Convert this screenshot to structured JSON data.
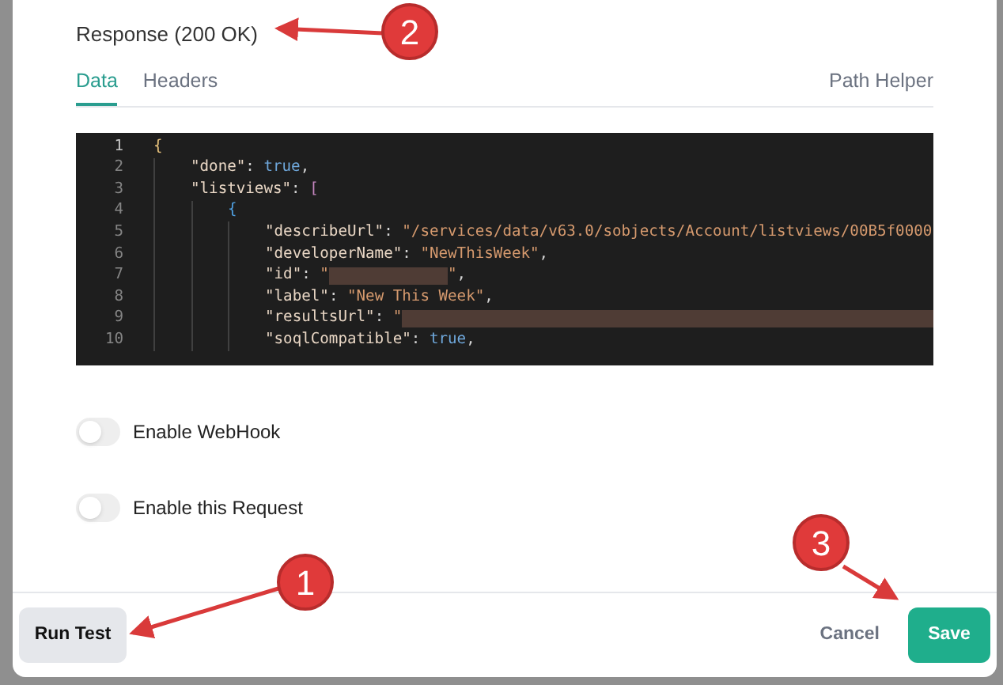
{
  "response": {
    "title": "Response (200 OK)"
  },
  "tabs": [
    {
      "label": "Data",
      "selected": true
    },
    {
      "label": "Headers",
      "selected": false
    }
  ],
  "path_helper": "Path Helper",
  "code_lines": [
    {
      "number": "1",
      "tokens": [
        {
          "kind": "bracket",
          "text": "{"
        }
      ],
      "children": [
        {
          "number": "2",
          "tokens": [
            {
              "kind": "key",
              "text": "\"done\""
            },
            {
              "kind": "punct",
              "text": ": "
            },
            {
              "kind": "literal",
              "text": "true"
            },
            {
              "kind": "punct",
              "text": ","
            }
          ]
        },
        {
          "number": "3",
          "tokens": [
            {
              "kind": "key",
              "text": "\"listviews\""
            },
            {
              "kind": "punct",
              "text": ": "
            },
            {
              "kind": "bracket2",
              "text": "["
            }
          ],
          "children": [
            {
              "number": "4",
              "tokens": [
                {
                  "kind": "bracket3",
                  "text": "{"
                }
              ],
              "children": [
                {
                  "number": "5",
                  "tokens": [
                    {
                      "kind": "key",
                      "text": "\"describeUrl\""
                    },
                    {
                      "kind": "punct",
                      "text": ": "
                    },
                    {
                      "kind": "string",
                      "text": "\"/services/data/v63.0/sobjects/Account/listviews/00B5f0000"
                    }
                  ]
                },
                {
                  "number": "6",
                  "tokens": [
                    {
                      "kind": "key",
                      "text": "\"developerName\""
                    },
                    {
                      "kind": "punct",
                      "text": ": "
                    },
                    {
                      "kind": "string",
                      "text": "\"NewThisWeek\""
                    },
                    {
                      "kind": "punct",
                      "text": ","
                    }
                  ]
                },
                {
                  "number": "7",
                  "tokens": [
                    {
                      "kind": "key",
                      "text": "\"id\""
                    },
                    {
                      "kind": "punct",
                      "text": ": "
                    },
                    {
                      "kind": "string",
                      "text": "\""
                    },
                    {
                      "kind": "redacted-short"
                    },
                    {
                      "kind": "string",
                      "text": "\""
                    },
                    {
                      "kind": "punct",
                      "text": ","
                    }
                  ]
                },
                {
                  "number": "8",
                  "tokens": [
                    {
                      "kind": "key",
                      "text": "\"label\""
                    },
                    {
                      "kind": "punct",
                      "text": ": "
                    },
                    {
                      "kind": "string",
                      "text": "\"New This Week\""
                    },
                    {
                      "kind": "punct",
                      "text": ","
                    }
                  ]
                },
                {
                  "number": "9",
                  "tokens": [
                    {
                      "kind": "key",
                      "text": "\"resultsUrl\""
                    },
                    {
                      "kind": "punct",
                      "text": ": "
                    },
                    {
                      "kind": "string",
                      "text": "\""
                    },
                    {
                      "kind": "redacted-long"
                    }
                  ]
                },
                {
                  "number": "10",
                  "tokens": [
                    {
                      "kind": "key",
                      "text": "\"soqlCompatible\""
                    },
                    {
                      "kind": "punct",
                      "text": ": "
                    },
                    {
                      "kind": "literal",
                      "text": "true"
                    },
                    {
                      "kind": "punct",
                      "text": ","
                    }
                  ]
                }
              ]
            }
          ]
        }
      ]
    }
  ],
  "toggles": [
    {
      "label": "Enable WebHook",
      "on": false
    },
    {
      "label": "Enable this Request",
      "on": false
    }
  ],
  "footer": {
    "run_test": "Run Test",
    "cancel": "Cancel",
    "save": "Save"
  },
  "callouts": [
    {
      "number": "2"
    },
    {
      "number": "1"
    },
    {
      "number": "3"
    }
  ]
}
